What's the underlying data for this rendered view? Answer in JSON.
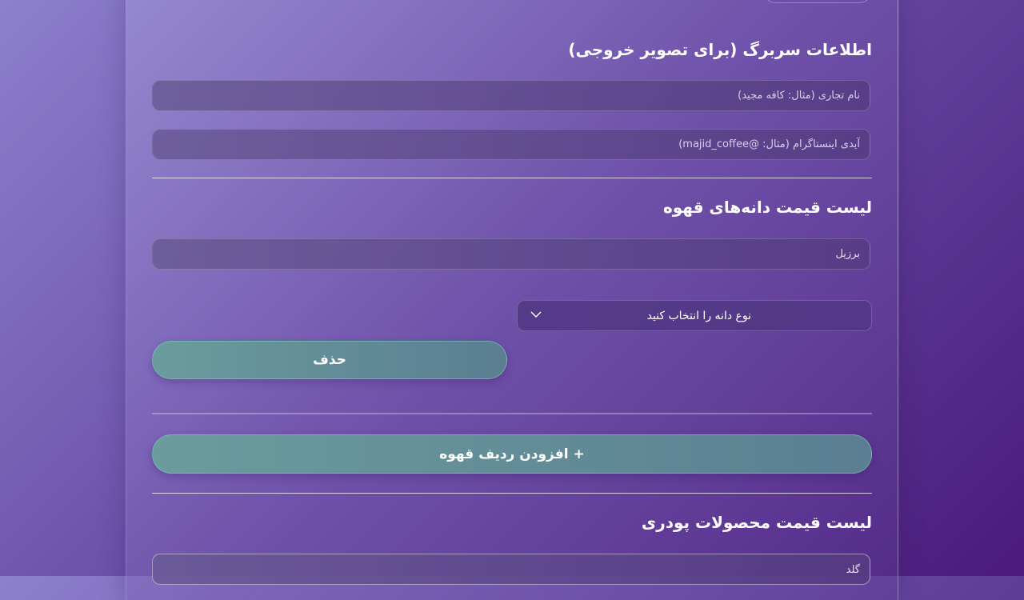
{
  "sections": {
    "shop_info_title": "اطلاعات سربرگ (برای تصویر خروجی)",
    "coffee_list_title": "لیست قیمت دانه‌های قهوه",
    "powder_list_title": "لیست قیمت محصولات پودری"
  },
  "inputs": {
    "business_name_placeholder": "نام تجاری (مثال: کافه مجید)",
    "instagram_placeholder": "آیدی اینستاگرام (مثال: @majid_coffee)",
    "coffee_row_value": "برزیل",
    "powder_row_value": "گلد"
  },
  "coffee_row": {
    "bean_type_selected": "نوع دانه را انتخاب کنید",
    "delete_label": "حذف"
  },
  "actions": {
    "add_coffee_row_label": "+ افزودن ردیف قهوه"
  }
}
